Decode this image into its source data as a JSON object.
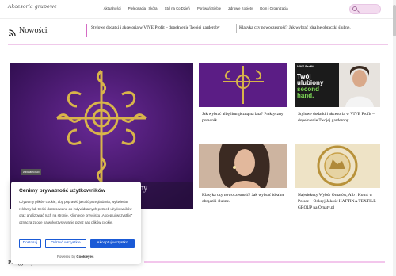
{
  "header": {
    "logo_text": "Akcesoria grupowe",
    "nav": [
      "Aktualności",
      "Pielęgnacja i Skóra",
      "Styl na Co Dzień",
      "Porówań Siebie",
      "Zdrowie Kobiety",
      "Dom i Organizacja"
    ],
    "search_placeholder": ""
  },
  "ticker": {
    "title": "Nowości",
    "items": [
      "Stylowe dodatki i akcesoria w VIVE Profit – dopełnienie Twojej garderoby",
      "Klasyka czy nowoczesność? Jak wybrać idealne obrączki ślubne."
    ]
  },
  "hero": {
    "badge": "Aktualności",
    "caption": "aktyczny"
  },
  "cards": [
    {
      "title": "Jak wybrać albę liturgiczną na lata? Praktyczny poradnik"
    },
    {
      "title": "Stylowe dodatki i akcesoria w VIVE Profit – dopełnienie Twojej garderoby",
      "image_text": [
        "VIVE Profit",
        "Twój",
        "ulubiony",
        "second",
        "hand."
      ]
    },
    {
      "title": "Klasyka czy nowoczesność? Jak wybrać idealne obrączki ślubne."
    },
    {
      "title": "Najwiekszy Wybór Ornatów, Alb i Komż w Polsce – Odkryj Jakość HAFTINA TEXTILE GROUP na Ornaty.pl"
    }
  ],
  "cookie": {
    "title": "Cenimy prywatność użytkowników",
    "text": "Używamy plików cookie, aby poprawić jakość przeglądania, wyświetlać reklamy lub treści dostosowane do indywidualnych potrzeb użytkowników oraz analizować ruch na stronie. Kliknięcie przycisku „Akceptuj wszystkie” oznacza zgodę na wykorzystywanie przez nas plików cookie.",
    "buttons": {
      "customize": "Dostosuj",
      "reject": "Odrzuć wszystkie",
      "accept": "Akceptuj wszystko"
    },
    "powered_prefix": "Powered by",
    "powered_brand": "Cookieyes"
  },
  "section": {
    "heading": "Pielęgnacja i Skóra"
  },
  "colors": {
    "accent_pink": "#d56bc4",
    "button_blue": "#1a5ad6",
    "hero_purple": "#4a1a72"
  }
}
